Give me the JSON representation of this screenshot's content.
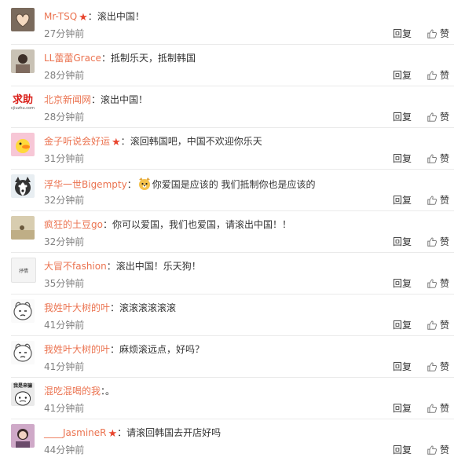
{
  "reply_label": "回复",
  "like_label": "赞",
  "comments": [
    {
      "username": "Mr-TSQ",
      "vip": true,
      "text": "滚出中国！",
      "time": "27分钟前",
      "avatar": "heart-hands"
    },
    {
      "username": "LL蕾蕾Grace",
      "vip": false,
      "text": "抵制乐天，抵制韩国",
      "time": "28分钟前",
      "avatar": "photo-person"
    },
    {
      "username": "北京新闻网",
      "vip": false,
      "text": "滚出中国！",
      "time": "28分钟前",
      "avatar": "qiuzhu-logo",
      "avatar_text": "求助",
      "avatar_subtext": "cjiuzhu.com"
    },
    {
      "username": "金子听说会好运",
      "vip": true,
      "text": "滚回韩国吧，中国不欢迎你乐天",
      "time": "31分钟前",
      "avatar": "duck-cartoon"
    },
    {
      "username": "浮华一世Bigempty",
      "vip": false,
      "text": "你爱国是应该的 我们抵制你也是应该的",
      "time": "32分钟前",
      "avatar": "husky-cartoon",
      "emoji_before_text": true
    },
    {
      "username": "疯狂的土豆go",
      "vip": false,
      "text": "你可以爱国，我们也爱国，请滚出中国！！",
      "time": "32分钟前",
      "avatar": "photo-room"
    },
    {
      "username": "大冒不fashion",
      "vip": false,
      "text": "滚出中国！乐天狗！",
      "time": "35分钟前",
      "avatar": "text-card",
      "avatar_text": "抒情"
    },
    {
      "username": "我姓叶大树的叶",
      "vip": false,
      "text": "滚滚滚滚滚滚",
      "time": "41分钟前",
      "avatar": "meme-face"
    },
    {
      "username": "我姓叶大树的叶",
      "vip": false,
      "text": "麻烦滚远点，好吗？",
      "time": "41分钟前",
      "avatar": "meme-face"
    },
    {
      "username": "混吃混喝的我",
      "vip": false,
      "text": "。",
      "time": "41分钟前",
      "avatar": "meme-bw",
      "avatar_text": "我是来骗"
    },
    {
      "username": "____JasmineR",
      "vip": true,
      "text": "请滚回韩国去开店好吗",
      "time": "44分钟前",
      "avatar": "photo-woman"
    }
  ]
}
